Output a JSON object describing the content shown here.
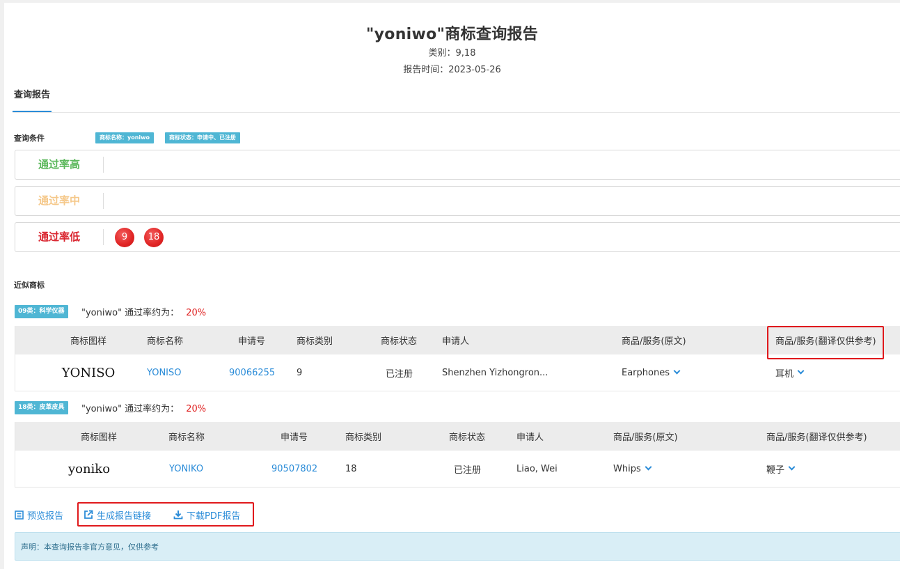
{
  "header": {
    "title": "\"yoniwo\"商标查询报告",
    "class_line": "类别：9,18",
    "date_line": "报告时间：2023-05-26"
  },
  "tab": {
    "label": "查询报告"
  },
  "conditions": {
    "label": "查询条件",
    "tags": [
      "商标名称：yoniwo",
      "商标状态：申请中、已注册"
    ],
    "rates": [
      {
        "label": "通过率高",
        "color": "#5cb85c",
        "classes": []
      },
      {
        "label": "通过率中",
        "color": "#f5c88a",
        "classes": []
      },
      {
        "label": "通过率低",
        "color": "#d9232d",
        "classes": [
          "9",
          "18"
        ]
      }
    ]
  },
  "similar": {
    "label": "近似商标",
    "groups": [
      {
        "tag": "09类：科学仪器",
        "text": "\"yoniwo\" 通过率约为：",
        "percent": "20%",
        "headers": [
          "商标图样",
          "商标名称",
          "申请号",
          "商标类别",
          "商标状态",
          "申请人",
          "商品/服务(原文)",
          "商品/服务(翻译仅供参考)"
        ],
        "row": {
          "logo": "YONISO",
          "name": "YONISO",
          "app_no": "90066255",
          "class": "9",
          "status": "已注册",
          "applicant": "Shenzhen Yizhongron...",
          "goods_en": "Earphones",
          "goods_cn": "耳机"
        }
      },
      {
        "tag": "18类：皮革皮具",
        "text": "\"yoniwo\" 通过率约为：",
        "percent": "20%",
        "headers": [
          "商标图样",
          "商标名称",
          "申请号",
          "商标类别",
          "商标状态",
          "申请人",
          "商品/服务(原文)",
          "商品/服务(翻译仅供参考)"
        ],
        "row": {
          "logo": "yoniko",
          "name": "YONIKO",
          "app_no": "90507802",
          "class": "18",
          "status": "已注册",
          "applicant": "Liao, Wei",
          "goods_en": "Whips",
          "goods_cn": "鞭子"
        }
      }
    ]
  },
  "actions": {
    "preview": "预览报告",
    "link": "生成报告链接",
    "pdf": "下载PDF报告"
  },
  "notice": "声明：本查询报告非官方意见，仅供参考",
  "colors": {
    "accent": "#2b8cd8",
    "tag_bg": "#4fb6d4",
    "danger": "#e02424",
    "highlight_box": "#e0191c"
  }
}
